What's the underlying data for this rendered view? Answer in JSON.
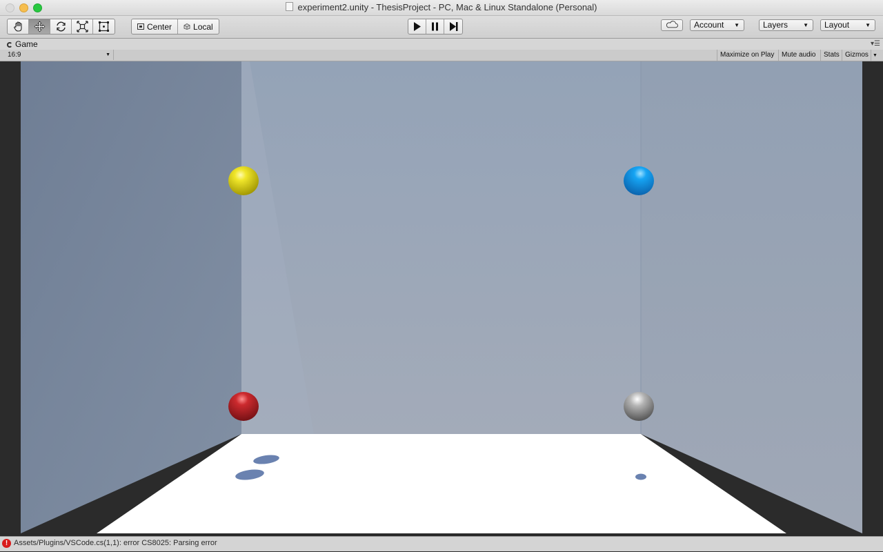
{
  "window": {
    "title": "experiment2.unity - ThesisProject - PC, Mac & Linux Standalone (Personal)"
  },
  "toolbar": {
    "transform_tools": [
      "hand-tool",
      "move-tool",
      "rotate-tool",
      "scale-tool",
      "rect-tool"
    ],
    "active_tool": "move-tool",
    "pivot_label": "Center",
    "space_label": "Local",
    "account_label": "Account",
    "layers_label": "Layers",
    "layout_label": "Layout"
  },
  "game_panel": {
    "tab_label": "Game",
    "aspect_label": "16:9",
    "maximize_on_play": "Maximize on Play",
    "mute_audio": "Mute audio",
    "stats": "Stats",
    "gizmos": "Gizmos"
  },
  "scene": {
    "spheres": [
      {
        "name": "yellow-sphere",
        "color": "#e3da17"
      },
      {
        "name": "blue-sphere",
        "color": "#1296e6"
      },
      {
        "name": "red-sphere",
        "color": "#c0262a"
      },
      {
        "name": "gray-sphere",
        "color": "#9a9a9a"
      }
    ],
    "left_wall_color": "#7a889c",
    "back_wall_color": "#9aa6b6",
    "right_wall_color": "#97a3b3",
    "floor_color": "#ffffff",
    "shadow_color": "#6a82b0"
  },
  "status": {
    "message": "Assets/Plugins/VSCode.cs(1,1): error CS8025: Parsing error",
    "level": "error"
  }
}
